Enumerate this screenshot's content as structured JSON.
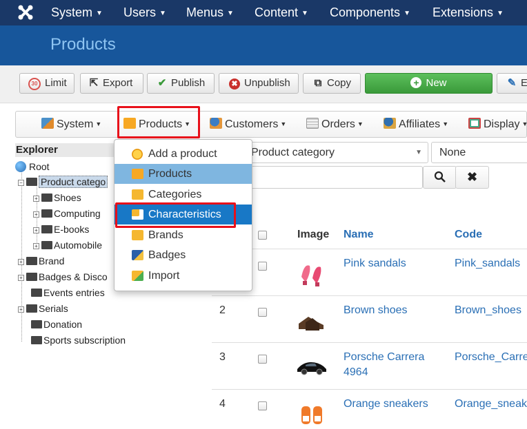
{
  "topbar": {
    "menus": [
      "System",
      "Users",
      "Menus",
      "Content",
      "Components",
      "Extensions"
    ]
  },
  "page_title": "Products",
  "toolbar": {
    "limit": "Limit",
    "limit_badge": "30",
    "export": "Export",
    "publish": "Publish",
    "unpublish": "Unpublish",
    "copy": "Copy",
    "new": "New",
    "edit_partial": "E"
  },
  "compbar": {
    "system": "System",
    "products": "Products",
    "customers": "Customers",
    "orders": "Orders",
    "affiliates": "Affiliates",
    "display": "Display"
  },
  "explorer": {
    "title": "Explorer",
    "root": "Root",
    "product_category": "Product catego",
    "children": [
      "Shoes",
      "Computing",
      "E-books",
      "Automobile"
    ],
    "brand": "Brand",
    "badges": "Badges & Disco",
    "events": "Events entries",
    "serials": "Serials",
    "donation": "Donation",
    "sports": "Sports subscription"
  },
  "filters": {
    "category": "Product category",
    "second": "None"
  },
  "products_menu": {
    "items": [
      "Add a product",
      "Products",
      "Categories",
      "Characteristics",
      "Brands",
      "Badges",
      "Import"
    ]
  },
  "table": {
    "headers": {
      "image": "Image",
      "name": "Name",
      "code": "Code"
    },
    "rows": [
      {
        "num": "",
        "name": "Pink sandals",
        "code": "Pink_sandals"
      },
      {
        "num": "2",
        "name": "Brown shoes",
        "code": "Brown_shoes"
      },
      {
        "num": "3",
        "name": "Porsche Carrera 4964",
        "code": "Porsche_Carre"
      },
      {
        "num": "4",
        "name": "Orange sneakers",
        "code": "Orange_sneak"
      }
    ]
  },
  "colors": {
    "topbar": "#1a3867",
    "titlebar": "#17569b",
    "link": "#2a6fb5",
    "highlight": "#e8101a",
    "new_button": "#3a9a3a"
  }
}
